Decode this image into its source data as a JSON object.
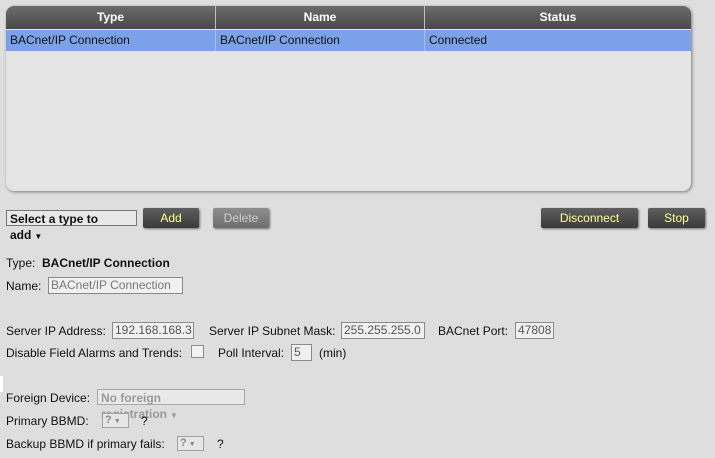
{
  "table": {
    "columns": [
      "Type",
      "Name",
      "Status"
    ],
    "rows": [
      {
        "type": "BACnet/IP Connection",
        "name": "BACnet/IP Connection",
        "status": "Connected"
      }
    ]
  },
  "toolbar": {
    "type_select": "Select a type to add",
    "add": "Add",
    "delete": "Delete",
    "disconnect": "Disconnect",
    "stop": "Stop"
  },
  "details": {
    "type_label": "Type:",
    "type_value": "BACnet/IP Connection",
    "name_label": "Name:",
    "name_value": "BACnet/IP Connection",
    "server_ip_label": "Server IP Address:",
    "server_ip_value": "192.168.168.3",
    "subnet_label": "Server IP Subnet Mask:",
    "subnet_value": "255.255.255.0",
    "port_label": "BACnet Port:",
    "port_value": "47808",
    "disable_alarms_label": "Disable Field Alarms and Trends:",
    "poll_label": "Poll Interval:",
    "poll_value": "5",
    "poll_unit": "(min)",
    "foreign_label": "Foreign Device:",
    "foreign_value": "No foreign registration",
    "primary_label": "Primary BBMD:",
    "primary_value": "?",
    "primary_help": "?",
    "backup_label": "Backup BBMD if primary fails:",
    "backup_value": "?",
    "backup_help": "?"
  },
  "colors": {
    "header_bg": "#4a4a4a",
    "selected_row": "#7ba2e8",
    "button_text": "#ffff99",
    "page_bg": "#dedede"
  }
}
